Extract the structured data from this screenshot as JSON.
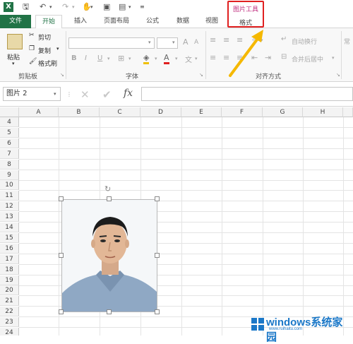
{
  "tabs": {
    "file": "文件",
    "home": "开始",
    "insert": "插入",
    "page_layout": "页面布局",
    "formulas": "公式",
    "data": "数据",
    "view": "视图",
    "picture_tools": "图片工具",
    "format": "格式"
  },
  "ribbon": {
    "paste": "粘贴",
    "cut": "剪切",
    "copy": "复制",
    "format_painter": "格式刷",
    "clipboard_label": "剪贴板",
    "font_label": "字体",
    "alignment_label": "对齐方式",
    "wrap_text": "自动换行",
    "merge_center": "合并后居中",
    "bold": "B",
    "italic": "I",
    "underline": "U",
    "grow_font": "A",
    "shrink_font": "A",
    "number_cut": "常"
  },
  "formula_bar": {
    "name_box": "图片 2",
    "fx": "fx"
  },
  "columns": [
    "A",
    "B",
    "C",
    "D",
    "E",
    "F",
    "G",
    "H"
  ],
  "rows": [
    "4",
    "5",
    "6",
    "7",
    "8",
    "9",
    "10",
    "11",
    "12",
    "13",
    "14",
    "15",
    "16",
    "17",
    "18",
    "19",
    "20",
    "21",
    "22",
    "23",
    "24"
  ],
  "watermark": {
    "title": "windows系统家园",
    "url": "www.ruihaitu.com"
  },
  "colors": {
    "excel_green": "#217346",
    "highlight_red": "#e02020",
    "arrow_yellow": "#f5b800",
    "tool_pink": "#c03080"
  }
}
